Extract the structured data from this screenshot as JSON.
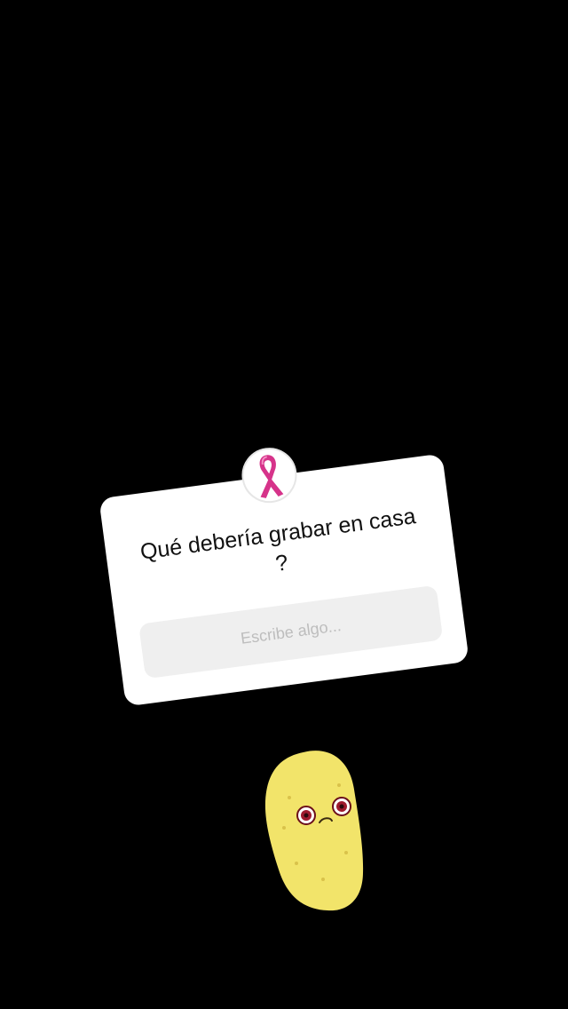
{
  "story": {
    "background_color": "#000000",
    "question_sticker": {
      "question": "Qué debería grabar en casa ?",
      "placeholder": "Escribe algo...",
      "avatar_icon": "pink-ribbon-icon",
      "accent_color": "#d6338a"
    },
    "sticker": {
      "icon": "potato-character-icon",
      "color": "#f2e46a"
    }
  }
}
